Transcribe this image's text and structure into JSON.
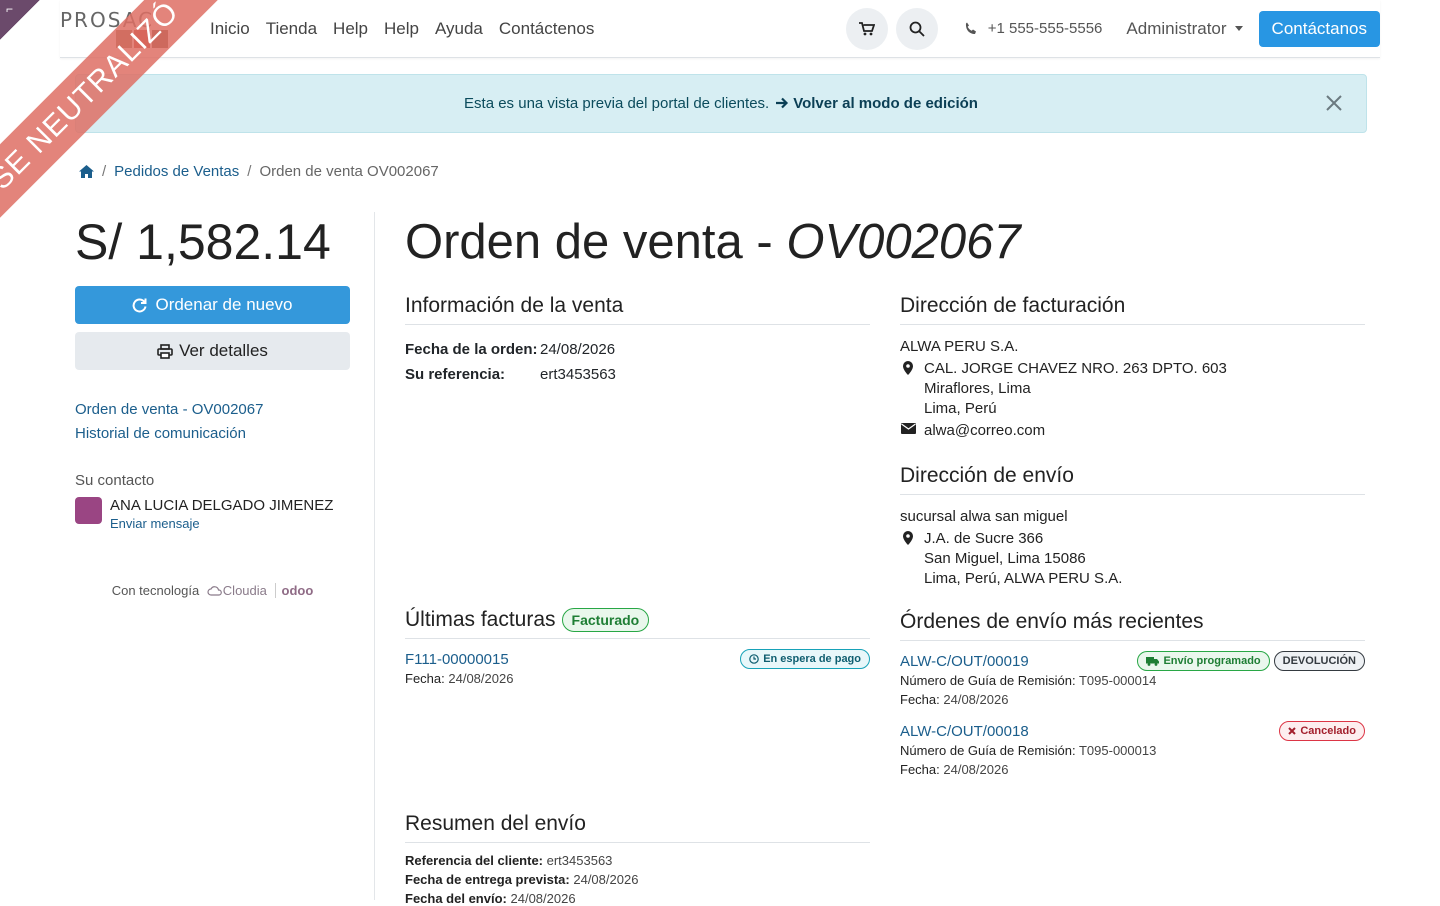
{
  "ribbon": {
    "text": "SE NEUTRALIZÓ",
    "corner_glyph": "⌐"
  },
  "navbar": {
    "logo_text": "PROSAC",
    "links": [
      "Inicio",
      "Tienda",
      "Help",
      "Help",
      "Ayuda",
      "Contáctenos"
    ],
    "phone": "+1 555-555-5556",
    "user": "Administrator",
    "contact_button": "Contáctanos"
  },
  "alert": {
    "message": "Esta es una vista previa del portal de clientes.",
    "link": "Volver al modo de edición"
  },
  "breadcrumb": {
    "items": [
      "Pedidos de Ventas",
      "Orden de venta OV002067"
    ]
  },
  "sidebar": {
    "amount": "S/ 1,582.14",
    "reorder_button": "Ordenar de nuevo",
    "details_button": "Ver detalles",
    "links": [
      "Orden de venta - OV002067",
      "Historial de comunicación"
    ],
    "contact_label": "Su contacto",
    "contact_name": "ANA LUCIA DELGADO JIMENEZ",
    "contact_action": "Enviar mensaje",
    "powered_by": "Con tecnología",
    "powered_brand1": "Cloudia",
    "powered_brand2": "odoo"
  },
  "main": {
    "title_prefix": "Orden de venta - ",
    "title_ref": "OV002067",
    "sale_info": {
      "heading": "Información de la venta",
      "order_date_label": "Fecha de la orden:",
      "order_date": "24/08/2026",
      "ref_label": "Su referencia:",
      "ref": "ert3453563"
    },
    "billing": {
      "heading": "Dirección de facturación",
      "name": "ALWA PERU S.A.",
      "lines": [
        "CAL. JORGE CHAVEZ NRO. 263 DPTO. 603",
        "Miraflores, Lima",
        "Lima, Perú"
      ],
      "email": "alwa@correo.com"
    },
    "shipping": {
      "heading": "Dirección de envío",
      "name": "sucursal alwa san miguel",
      "lines": [
        "J.A. de Sucre 366",
        "San Miguel, Lima 15086",
        "Lima, Perú, ALWA PERU S.A."
      ]
    },
    "invoices": {
      "heading": "Últimas facturas",
      "badge": "Facturado",
      "number": "F111-00000015",
      "date_label": "Fecha:",
      "date": "24/08/2026",
      "status": "En espera de pago"
    },
    "deliveries": {
      "heading": "Órdenes de envío más recientes",
      "items": [
        {
          "ref": "ALW-C/OUT/00019",
          "guide_label": "Número de Guía de Remisión:",
          "guide": "T095-000014",
          "date_label": "Fecha:",
          "date": "24/08/2026",
          "status": "Envío programado",
          "extra": "DEVOLUCIÓN"
        },
        {
          "ref": "ALW-C/OUT/00018",
          "guide_label": "Número de Guía de Remisión:",
          "guide": "T095-000013",
          "date_label": "Fecha:",
          "date": "24/08/2026",
          "status": "Cancelado"
        }
      ]
    },
    "summary": {
      "heading": "Resumen del envío",
      "client_ref_label": "Referencia del cliente:",
      "client_ref": "ert3453563",
      "delivery_label": "Fecha de entrega prevista:",
      "delivery": "24/08/2026",
      "cut_label": "Fecha del envío:",
      "cut": "24/08/2026"
    }
  }
}
